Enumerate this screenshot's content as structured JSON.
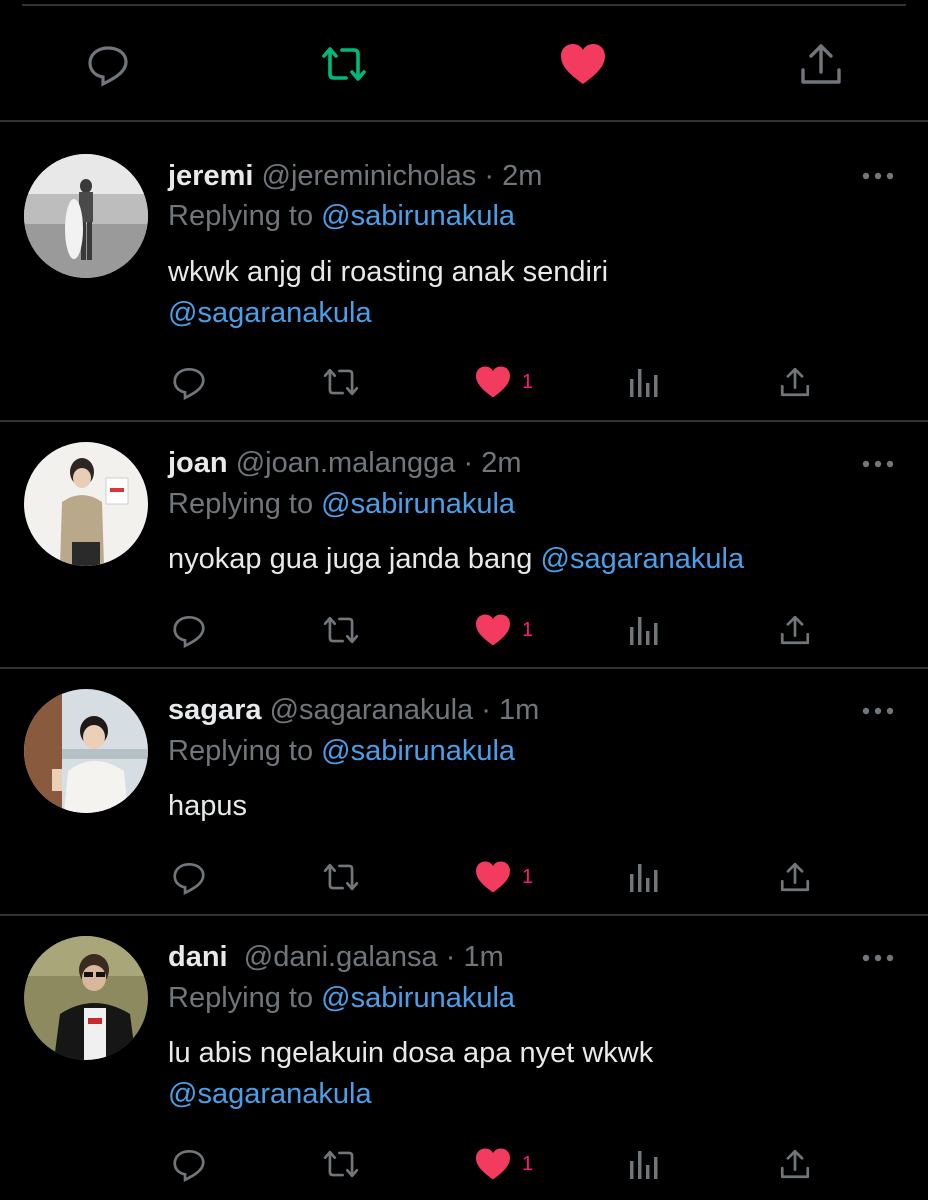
{
  "main_tweet_actions": {
    "reply_icon": "reply-icon",
    "retweet_icon": "retweet-icon",
    "like_icon": "heart-filled-icon",
    "share_icon": "share-icon"
  },
  "colors": {
    "background": "#000000",
    "divider": "#2f3336",
    "muted": "#71767b",
    "mention": "#4a9fe8",
    "like": "#f91880",
    "retweet_active": "#00ba7c",
    "heart": "#f33a5f"
  },
  "replies": [
    {
      "name": "jeremi",
      "handle": "@jereminicholas",
      "sep": "·",
      "time": "2m",
      "replying_prefix": "Replying to",
      "replying_to": "@sabirunakula",
      "text": "wkwk anjg di roasting anak sendiri",
      "text_mention": "@sagaranakula",
      "like_count": "1"
    },
    {
      "name": "joan",
      "handle": "@joan.malangga",
      "sep": "·",
      "time": "2m",
      "replying_prefix": "Replying to",
      "replying_to": "@sabirunakula",
      "text": "nyokap gua juga janda bang",
      "text_mention": "@sagaranakula",
      "like_count": "1"
    },
    {
      "name": "sagara",
      "handle": "@sagaranakula",
      "sep": "·",
      "time": "1m",
      "replying_prefix": "Replying to",
      "replying_to": "@sabirunakula",
      "text": "hapus",
      "text_mention": "",
      "like_count": "1"
    },
    {
      "name": "dani",
      "handle": "@dani.galansa",
      "sep": "·",
      "time": "1m",
      "replying_prefix": "Replying to",
      "replying_to": "@sabirunakula",
      "text": "lu abis ngelakuin dosa apa nyet wkwk",
      "text_mention": "@sagaranakula",
      "like_count": "1"
    }
  ]
}
